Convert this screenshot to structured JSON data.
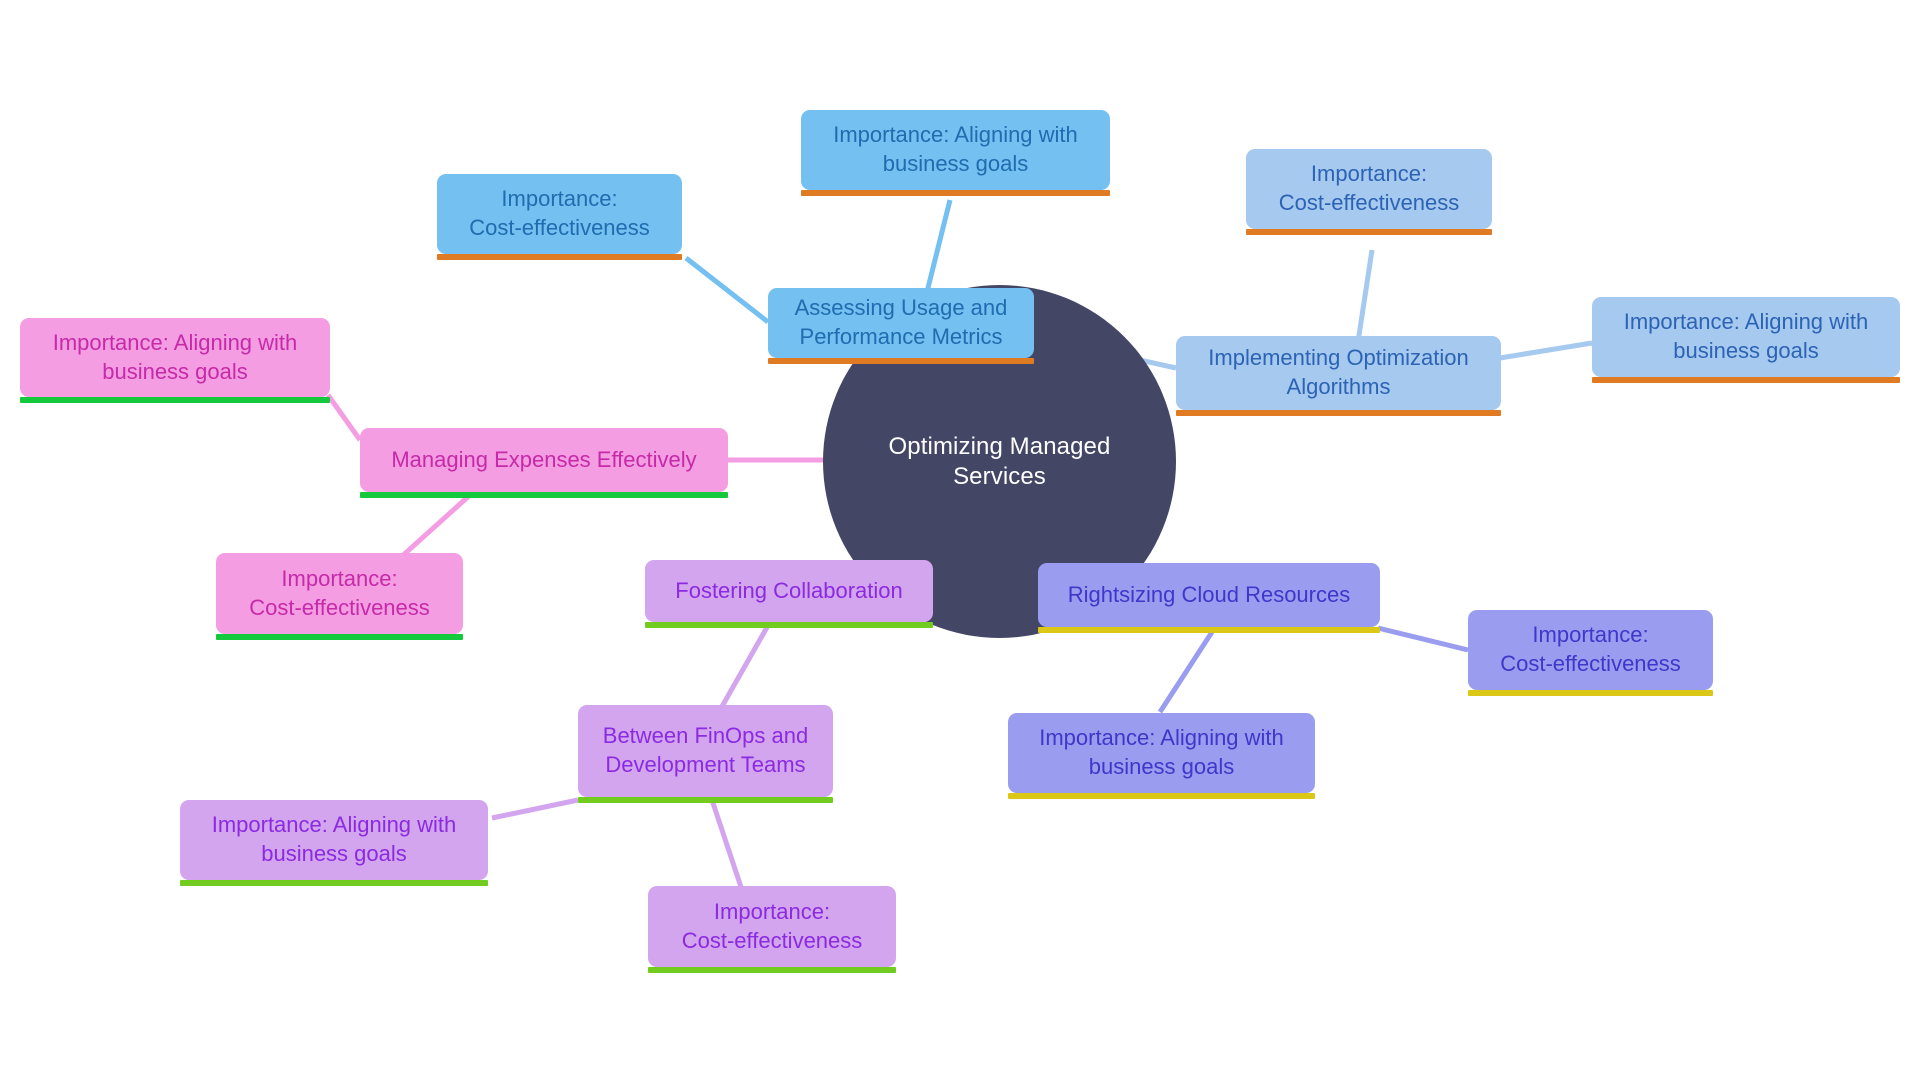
{
  "diagram": {
    "title": "Optimizing Managed Services mind map",
    "background": "#ffffff",
    "root": {
      "label": "Optimizing Managed Services",
      "fill": "#434665",
      "text_color": "#ffffff"
    },
    "palette": {
      "blue_fill": "#74c0f0",
      "blue_text": "#1f6cb0",
      "lightblue_fill": "#a5c9ef",
      "lightblue_text": "#2d63b4",
      "pink_fill": "#f59de2",
      "pink_text": "#c52aa8",
      "purple_fill": "#d2a5ee",
      "purple_text": "#8b2ae0",
      "periwinkle_fill": "#9a9cf0",
      "periwinkle_text": "#3f37c9",
      "underline_orange": "#e07b24",
      "underline_green": "#15c93c",
      "underline_lime": "#72cc20",
      "underline_yellow": "#dbc716"
    },
    "branches": [
      {
        "id": "assessing",
        "label": "Assessing Usage and\nPerformance Metrics",
        "color_key": "blue",
        "underline_key": "orange",
        "children": [
          {
            "id": "assessing-c1",
            "label": "Importance: Aligning with\nbusiness goals"
          },
          {
            "id": "assessing-c2",
            "label": "Importance:\nCost-effectiveness"
          }
        ]
      },
      {
        "id": "implementing",
        "label": "Implementing Optimization\nAlgorithms",
        "color_key": "lightblue",
        "underline_key": "orange",
        "children": [
          {
            "id": "implementing-c1",
            "label": "Importance:\nCost-effectiveness"
          },
          {
            "id": "implementing-c2",
            "label": "Importance: Aligning with\nbusiness goals"
          }
        ]
      },
      {
        "id": "managing",
        "label": "Managing Expenses Effectively",
        "color_key": "pink",
        "underline_key": "green",
        "children": [
          {
            "id": "managing-c1",
            "label": "Importance: Aligning with\nbusiness goals"
          },
          {
            "id": "managing-c2",
            "label": "Importance:\nCost-effectiveness"
          }
        ]
      },
      {
        "id": "fostering",
        "label": "Fostering Collaboration",
        "color_key": "purple",
        "underline_key": "lime",
        "children": [
          {
            "id": "fostering-c1",
            "label": "Between FinOps and\nDevelopment Teams"
          },
          {
            "id": "fostering-c2",
            "label": "Importance: Aligning with\nbusiness goals"
          },
          {
            "id": "fostering-c3",
            "label": "Importance:\nCost-effectiveness"
          }
        ]
      },
      {
        "id": "rightsizing",
        "label": "Rightsizing Cloud Resources",
        "color_key": "periwinkle",
        "underline_key": "yellow",
        "children": [
          {
            "id": "rightsizing-c1",
            "label": "Importance:\nCost-effectiveness"
          },
          {
            "id": "rightsizing-c2",
            "label": "Importance: Aligning with\nbusiness goals"
          }
        ]
      }
    ]
  }
}
